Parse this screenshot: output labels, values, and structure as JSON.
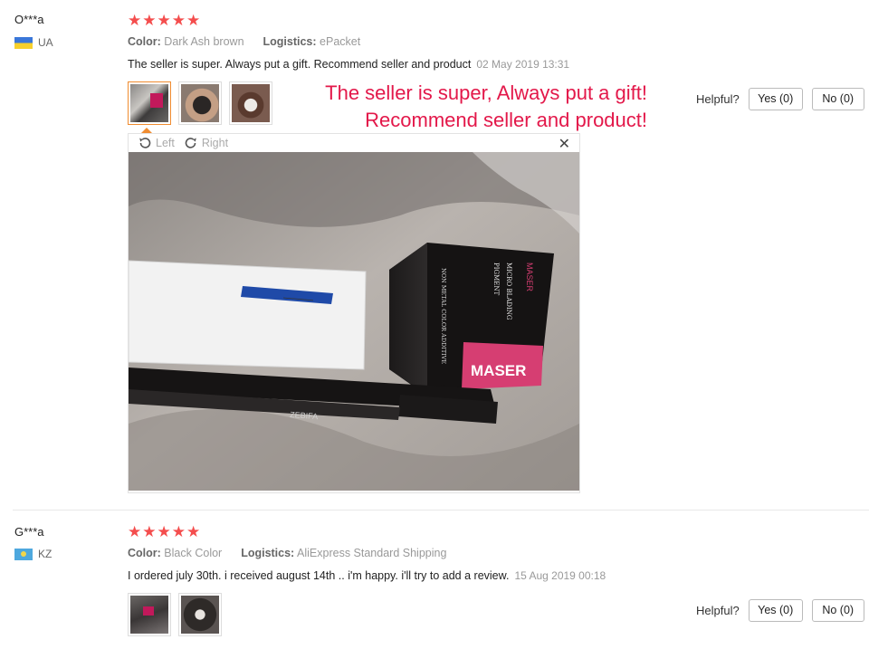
{
  "reviews": [
    {
      "user": "O***a",
      "country": "UA",
      "stars": "★★★★★",
      "color_label": "Color:",
      "color_value": "Dark Ash brown",
      "logistics_label": "Logistics:",
      "logistics_value": "ePacket",
      "text": "The seller is super. Always put a gift. Recommend seller and product",
      "date": "02 May 2019 13:31",
      "caption_line1": "The seller is super, Always put a gift!",
      "caption_line2": "Recommend seller and product!",
      "helpful_label": "Helpful?",
      "yes_label": "Yes (0)",
      "no_label": "No (0)",
      "viewer": {
        "left_label": "Left",
        "right_label": "Right",
        "close_glyph": "✕",
        "photo_texts": {
          "box_vertical": "NON METAL COLOR ADDITIVE",
          "box_text1": "MICRO BLADING",
          "box_text2": "PIGMENT",
          "box_brand": "MASER",
          "pen_brand": "ZEBIFA"
        }
      }
    },
    {
      "user": "G***a",
      "country": "KZ",
      "stars": "★★★★★",
      "color_label": "Color:",
      "color_value": "Black Color",
      "logistics_label": "Logistics:",
      "logistics_value": "AliExpress Standard Shipping",
      "text": "I ordered july 30th. i received august 14th .. i'm happy. i'll try to add a review.",
      "date": "15 Aug 2019 00:18",
      "helpful_label": "Helpful?",
      "yes_label": "Yes (0)",
      "no_label": "No (0)"
    }
  ],
  "colors": {
    "star": "#f44d4d",
    "caption": "#e3184a",
    "accent_border": "#f08c30"
  }
}
